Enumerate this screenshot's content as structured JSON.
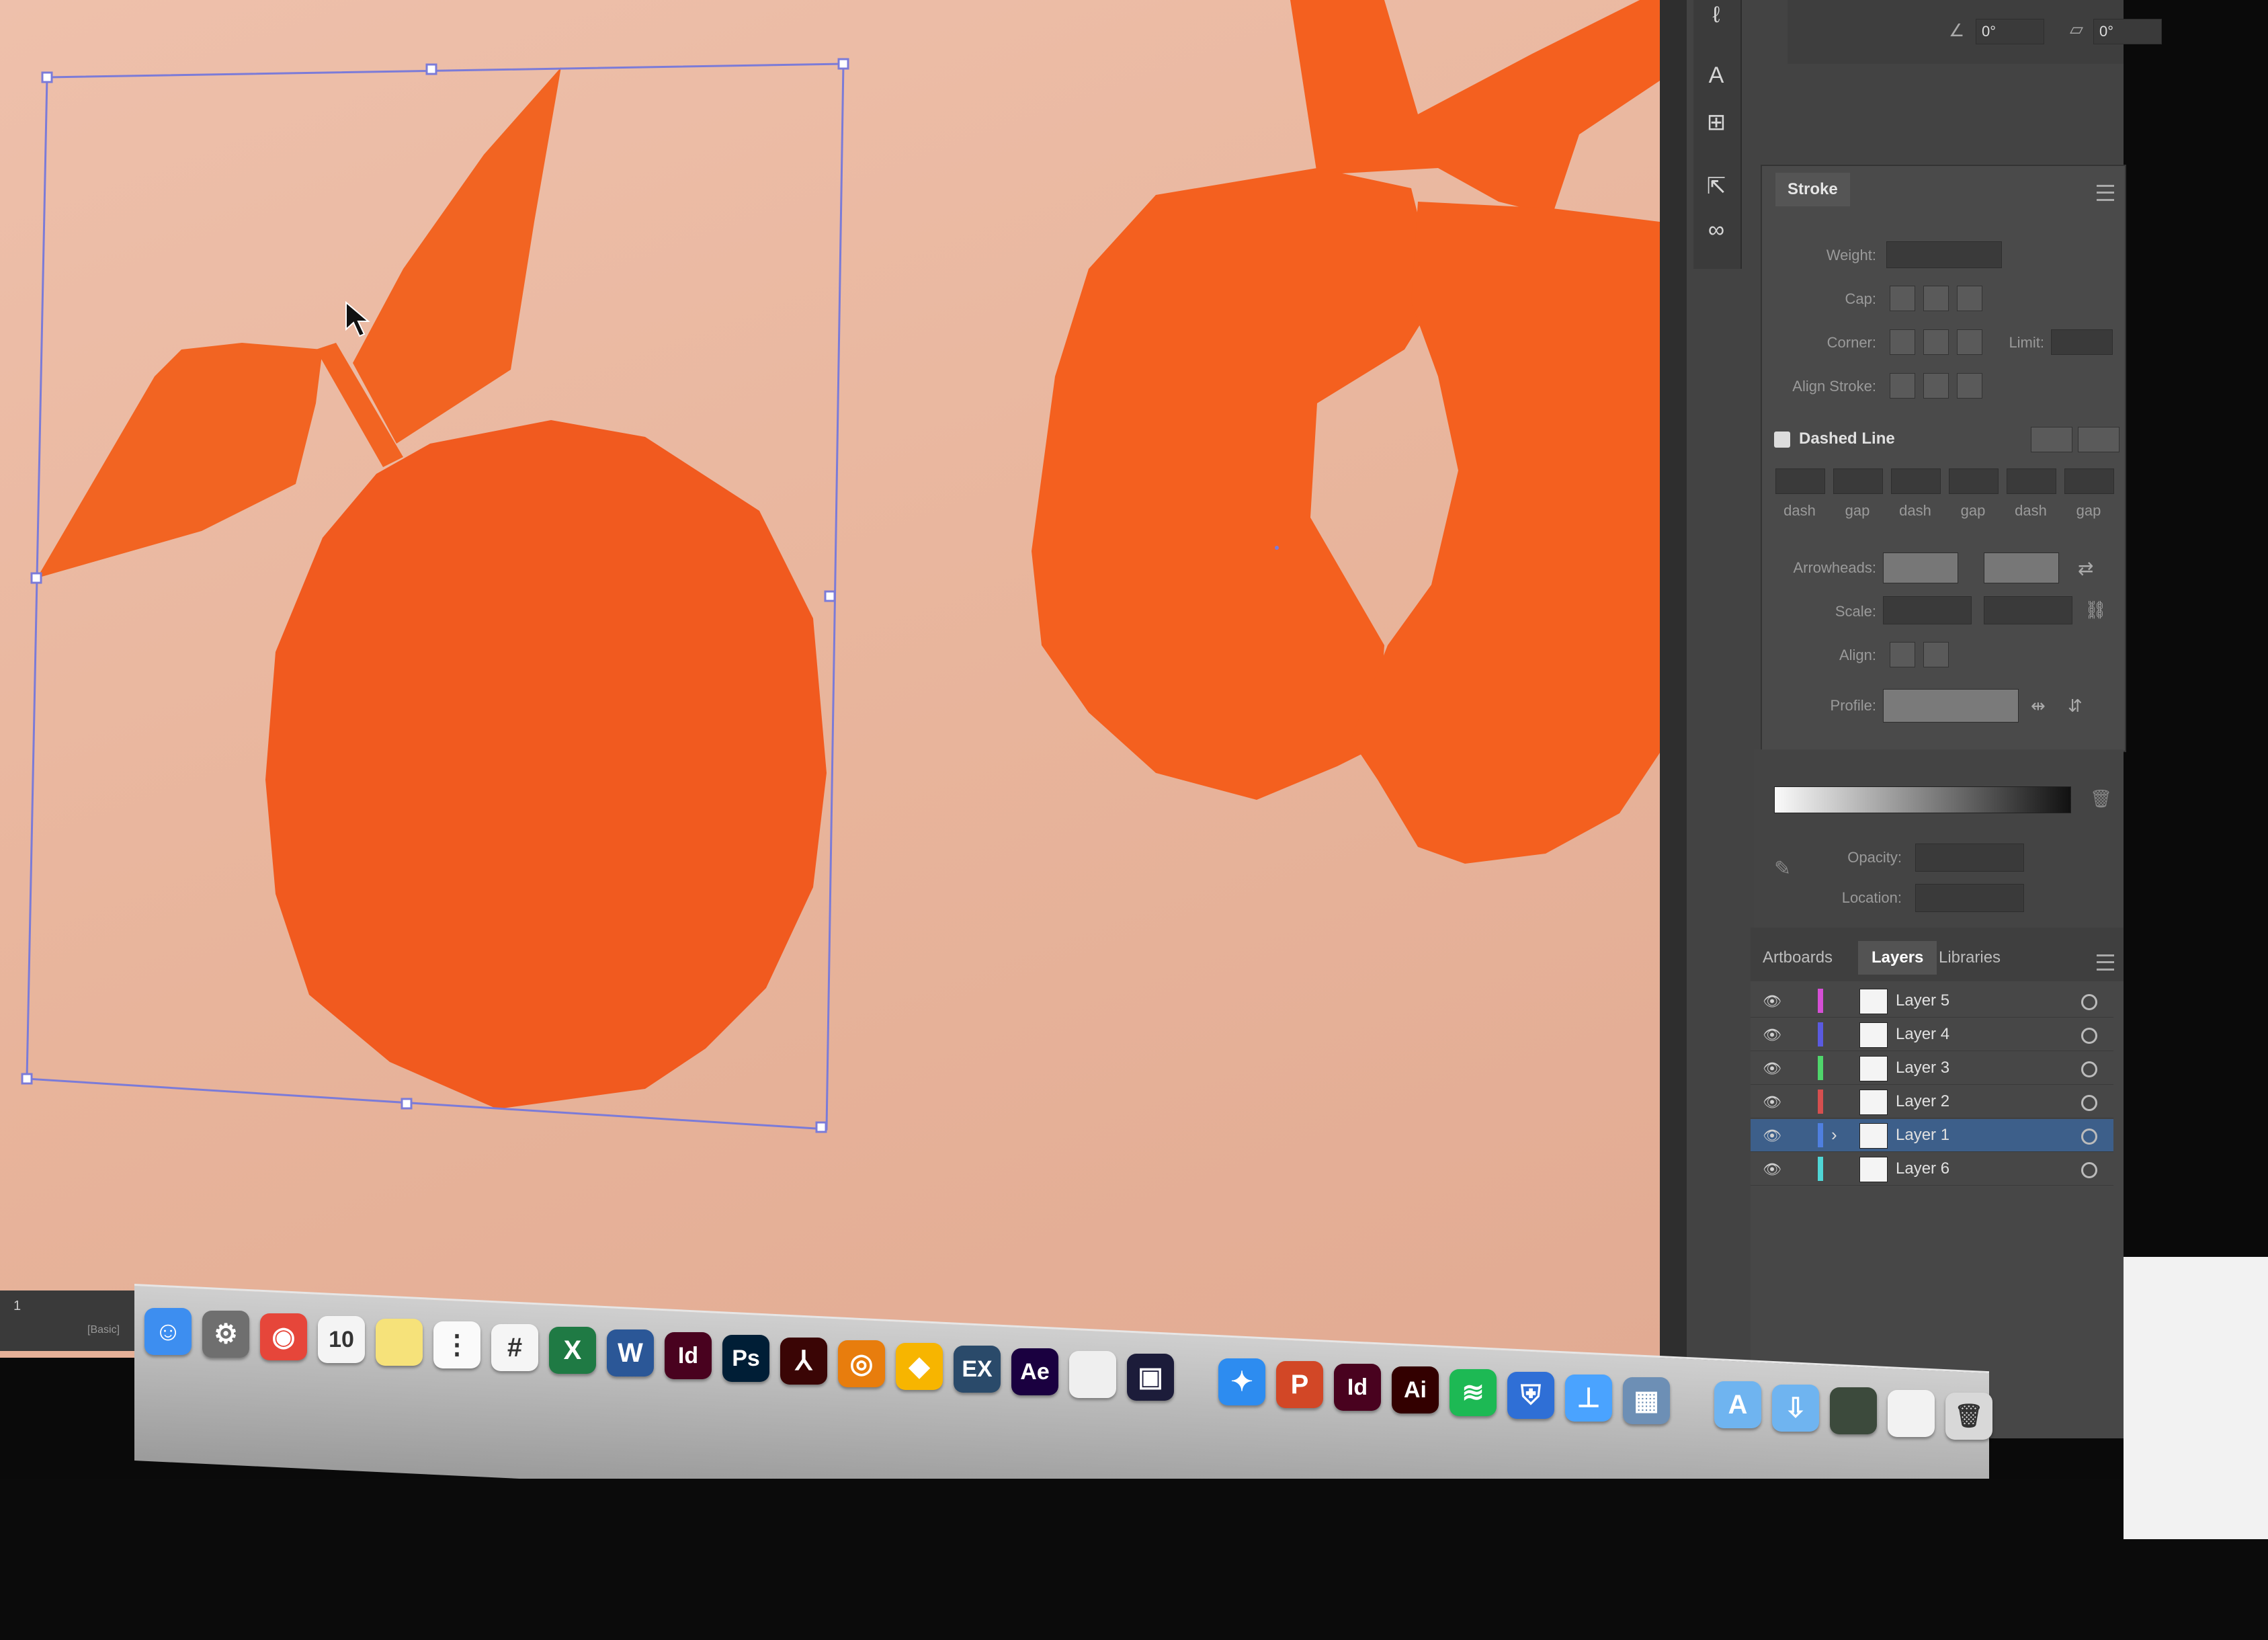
{
  "colors": {
    "artboard_bg": "#e8b49b",
    "fruit_orange": "#f26422",
    "fruit_orange_dark": "#f15a1f",
    "selection_blue": "#7b7bd8",
    "panel_bg": "#434343"
  },
  "tool_icons": [
    "pen-icon",
    "type-on-path-icon",
    "symbol-sprayer-icon",
    "export-icon",
    "link-icon"
  ],
  "stroke_panel": {
    "title": "Stroke",
    "weight_label": "Weight:",
    "cap_label": "Cap:",
    "corner_label": "Corner:",
    "limit_label": "Limit:",
    "align_label": "Align Stroke:",
    "dashed_label": "Dashed Line",
    "dash_fields": [
      "dash",
      "gap",
      "dash",
      "gap",
      "dash",
      "gap"
    ],
    "arrowheads_label": "Arrowheads:",
    "scale_label": "Scale:",
    "align2_label": "Align:",
    "profile_label": "Profile:",
    "opacity_label": "Opacity:",
    "location_label": "Location:",
    "angle_value_1": "0°",
    "angle_value_2": "0°"
  },
  "layers_panel": {
    "tabs": [
      "Artboards",
      "Layers",
      "Libraries"
    ],
    "active_tab": "Layers",
    "layers": [
      {
        "name": "Layer 5",
        "color": "#d64fd6"
      },
      {
        "name": "Layer 4",
        "color": "#5a5ae0"
      },
      {
        "name": "Layer 3",
        "color": "#4fd66b"
      },
      {
        "name": "Layer 2",
        "color": "#d64f4f"
      },
      {
        "name": "Layer 1",
        "color": "#4f7fe0",
        "selected": true
      },
      {
        "name": "Layer 6",
        "color": "#4fd6d6"
      }
    ]
  },
  "status": {
    "page_value": "1",
    "preset": "[Basic]"
  },
  "dock": {
    "apps": [
      {
        "icon": "finder-icon",
        "glyph": "☺",
        "color": "#3d8ef0"
      },
      {
        "icon": "system-preferences-icon",
        "glyph": "⚙",
        "color": "#6f6f6f"
      },
      {
        "icon": "chrome-icon",
        "glyph": "◉",
        "color": "#e6463a"
      },
      {
        "icon": "calendar-icon",
        "glyph": "10",
        "color": "#f4f4f4"
      },
      {
        "icon": "notes-icon",
        "glyph": "",
        "color": "#f6e27a"
      },
      {
        "icon": "reminders-icon",
        "glyph": "⋮",
        "color": "#fafafa"
      },
      {
        "icon": "slack-icon",
        "glyph": "#",
        "color": "#f5f5f5"
      },
      {
        "icon": "excel-icon",
        "glyph": "X",
        "color": "#1f7a44"
      },
      {
        "icon": "word-icon",
        "glyph": "W",
        "color": "#2b5797"
      },
      {
        "icon": "indesign-icon",
        "glyph": "Id",
        "color": "#49021f"
      },
      {
        "icon": "photoshop-icon",
        "glyph": "Ps",
        "color": "#001e36"
      },
      {
        "icon": "acrobat-icon",
        "glyph": "⅄",
        "color": "#3a0505"
      },
      {
        "icon": "blender-icon",
        "glyph": "◎",
        "color": "#e87d0d"
      },
      {
        "icon": "sketch-icon",
        "glyph": "◆",
        "color": "#f7b500"
      },
      {
        "icon": "exposure-icon",
        "glyph": "EX",
        "color": "#2a4a6a"
      },
      {
        "icon": "after-effects-icon",
        "glyph": "Ae",
        "color": "#1a0040"
      },
      {
        "icon": "textedit-icon",
        "glyph": "",
        "color": "#efefef"
      },
      {
        "icon": "media-encoder-icon",
        "glyph": "▣",
        "color": "#1c1c3a"
      },
      {
        "icon": "safari-icon",
        "glyph": "✦",
        "color": "#2d8cf0"
      },
      {
        "icon": "powerpoint-icon",
        "glyph": "P",
        "color": "#d24726"
      },
      {
        "icon": "indesign-2-icon",
        "glyph": "Id",
        "color": "#49021f"
      },
      {
        "icon": "illustrator-icon",
        "glyph": "Ai",
        "color": "#330000"
      },
      {
        "icon": "spotify-icon",
        "glyph": "≋",
        "color": "#1db954"
      },
      {
        "icon": "security-shield-icon",
        "glyph": "⛨",
        "color": "#2f6fd6"
      },
      {
        "icon": "keynote-icon",
        "glyph": "⊥",
        "color": "#4aa3ff"
      },
      {
        "icon": "preview-icon",
        "glyph": "▦",
        "color": "#6d8fb5"
      },
      {
        "icon": "applications-folder-icon",
        "glyph": "A",
        "color": "#6fb4f0"
      },
      {
        "icon": "downloads-folder-icon",
        "glyph": "⇩",
        "color": "#6fb4f0"
      },
      {
        "icon": "document-stack-icon",
        "glyph": "",
        "color": "#3c4a3c"
      },
      {
        "icon": "documents-stack-icon",
        "glyph": "",
        "color": "#f2f2f2"
      },
      {
        "icon": "trash-icon",
        "glyph": "🗑",
        "color": "#d8d8d8"
      }
    ]
  }
}
